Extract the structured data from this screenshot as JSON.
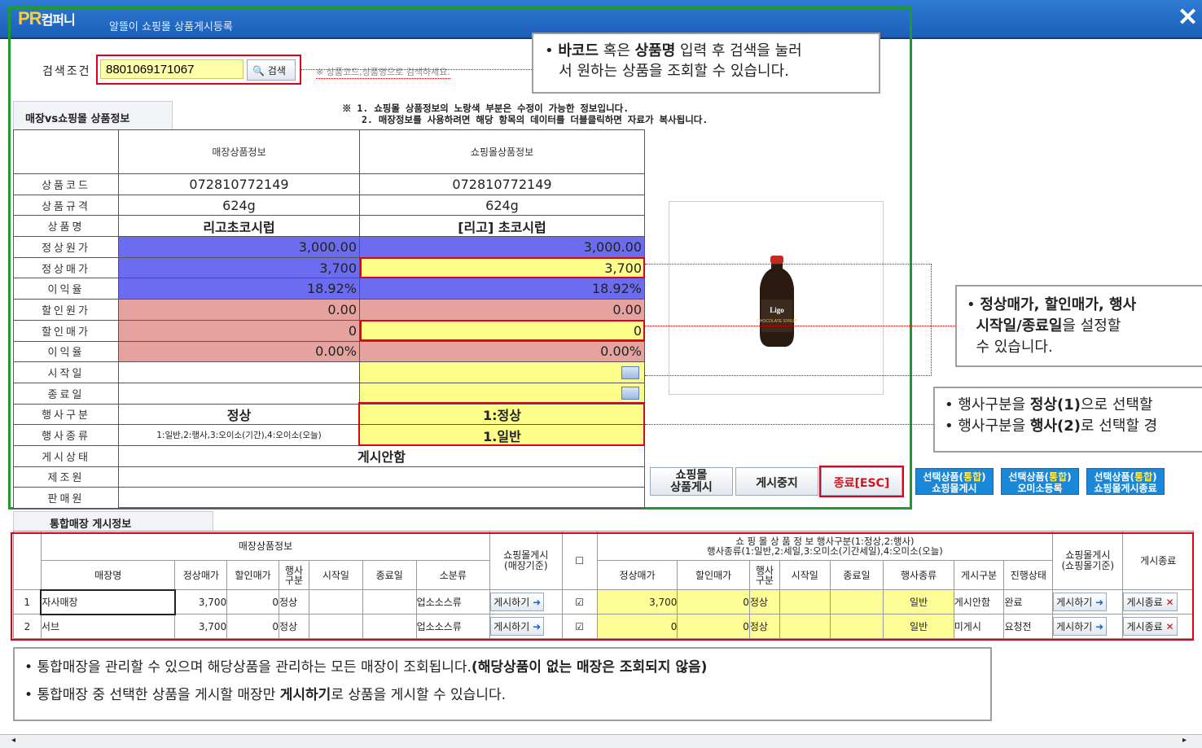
{
  "window": {
    "logo_main": "PR",
    "logo_sub": "컴퍼니",
    "title": "알뜰이 쇼핑몰 상품게시등록",
    "close": "✕"
  },
  "search": {
    "label": "검색조건",
    "value": "8801069171067",
    "button": "검색",
    "hint": "※ 상품코드,상품명으로 검색하세요."
  },
  "callout_top": {
    "b1": "바코드",
    "t1": " 혹은 ",
    "b2": "상품명",
    "t2": " 입력 후 검색을 눌러",
    "line2": "서 원하는 상품을 조회할 수 있습니다."
  },
  "tab": "매장vs쇼핑몰 상품정보",
  "notes": {
    "line1": "※ 1. 쇼핑몰 상품정보의 노랑색 부분은 수정이 가능한 정보입니다.",
    "line2": "2. 매장정보를 사용하려면 해당 항목의 데이터를 더블클릭하면 자료가 복사됩니다."
  },
  "compare": {
    "head_store": "매장상품정보",
    "head_mall": "쇼핑몰상품정보",
    "labels": [
      "상품코드",
      "상품규격",
      "상품명",
      "정상원가",
      "정상매가",
      "이익율",
      "할인원가",
      "할인매가",
      "이익율",
      "시작일",
      "종료일",
      "행사구분",
      "행사종류",
      "게시상태",
      "제조원",
      "판매원"
    ],
    "store": [
      "072810772149",
      "624g",
      "리고초코시럽",
      "3,000.00",
      "3,700",
      "18.92%",
      "0.00",
      "0",
      "0.00%",
      "",
      "",
      "정상",
      "1:일반,2:행사,3:오이소(기간),4:오이소(오늘)",
      "게시안함",
      "",
      ""
    ],
    "mall": [
      "072810772149",
      "624g",
      "[리고] 초코시럽",
      "3,000.00",
      "3,700",
      "18.92%",
      "0.00",
      "0",
      "0.00%",
      "",
      "",
      "1:정상",
      "1.일반",
      "",
      "",
      ""
    ]
  },
  "product": {
    "brand": "Ligo",
    "name": "CHOCOLATE SYRUP"
  },
  "callout_mid": {
    "b1": "정상매가, 할인매가, 행사",
    "b2": "시작일/종료일",
    "t": "을 설정할",
    "line3": "수 있습니다."
  },
  "callout_event": {
    "l1a": "행사구분을 ",
    "l1b": "정상(1)",
    "l1c": "으로 선택할",
    "l2a": "행사구분을 ",
    "l2b": "행사(2)",
    "l2c": "로 선택할 경"
  },
  "buttons": {
    "mall_post": "쇼핑몰\n상품게시",
    "stop": "게시중지",
    "exit": "종료[ESC]",
    "b1a": "선택상품(",
    "b1b": "통합",
    "b1c": ")",
    "b1d": "쇼핑몰게시",
    "b2a": "선택상품(",
    "b2b": "통합",
    "b2c": ")",
    "b2d": "오미소등록",
    "b3a": "선택상품(",
    "b3b": "통합",
    "b3c": ")",
    "b3d": "쇼핑몰게시종료"
  },
  "section2": "통합매장 게시정보",
  "grid": {
    "h_store_info": "매장상품정보",
    "h_post_store": "쇼핑몰게시\n(매장기준)",
    "h_mall_info": "쇼 핑 몰 상 품 정 보        행사구분(1:정상,2:행사)\n행사종류(1:일반,2:세일,3:오미소(기간세일),4:오미소(오늘)",
    "h_post_mall": "쇼핑몰게시\n(쇼핑몰기준)",
    "h_end": "게시종료",
    "cols_store": [
      "매장명",
      "정상매가",
      "할인매가",
      "행사\n구분",
      "시작일",
      "종료일",
      "소분류"
    ],
    "cols_mall": [
      "정상매가",
      "할인매가",
      "행사\n구분",
      "시작일",
      "종료일",
      "행사종류",
      "게시구분",
      "진행상태"
    ],
    "rows": [
      {
        "no": "1",
        "name": "자사매장",
        "price": "3,700",
        "disc": "0",
        "ev": "정상",
        "start": "",
        "end": "",
        "cat": "업소소스류",
        "post": "게시하기",
        "chk": "☑",
        "mprice": "3,700",
        "mdisc": "0",
        "mev": "정상",
        "mstart": "",
        "mend": "",
        "kind": "일반",
        "pstat": "게시안함",
        "prog": "완료",
        "post2": "게시하기",
        "endb": "게시종료"
      },
      {
        "no": "2",
        "name": "서브",
        "price": "3,700",
        "disc": "0",
        "ev": "정상",
        "start": "",
        "end": "",
        "cat": "업소소스류",
        "post": "게시하기",
        "chk": "☑",
        "mprice": "0",
        "mdisc": "0",
        "mev": "정상",
        "mstart": "",
        "mend": "",
        "kind": "일반",
        "pstat": "미게시",
        "prog": "요청전",
        "post2": "게시하기",
        "endb": "게시종료"
      }
    ]
  },
  "callout_bottom": {
    "l1": "통합매장을 관리할 수 있으며 해당상품을 관리하는 모든 매장이 조회됩니다.",
    "l1b": "(해당상품이 없는 매장은 조회되지 않음)",
    "l2a": "통합매장 중 선택한 상품을 게시할 매장만 ",
    "l2b": "게시하기",
    "l2c": "로 상품을 게시할 수 있습니다."
  },
  "colors": {
    "blue": "#6c6cf0",
    "pink": "#e6a29e",
    "yellow": "#fdfd8a",
    "green_border": "#1e9b2a",
    "red_border": "#e0001a"
  }
}
